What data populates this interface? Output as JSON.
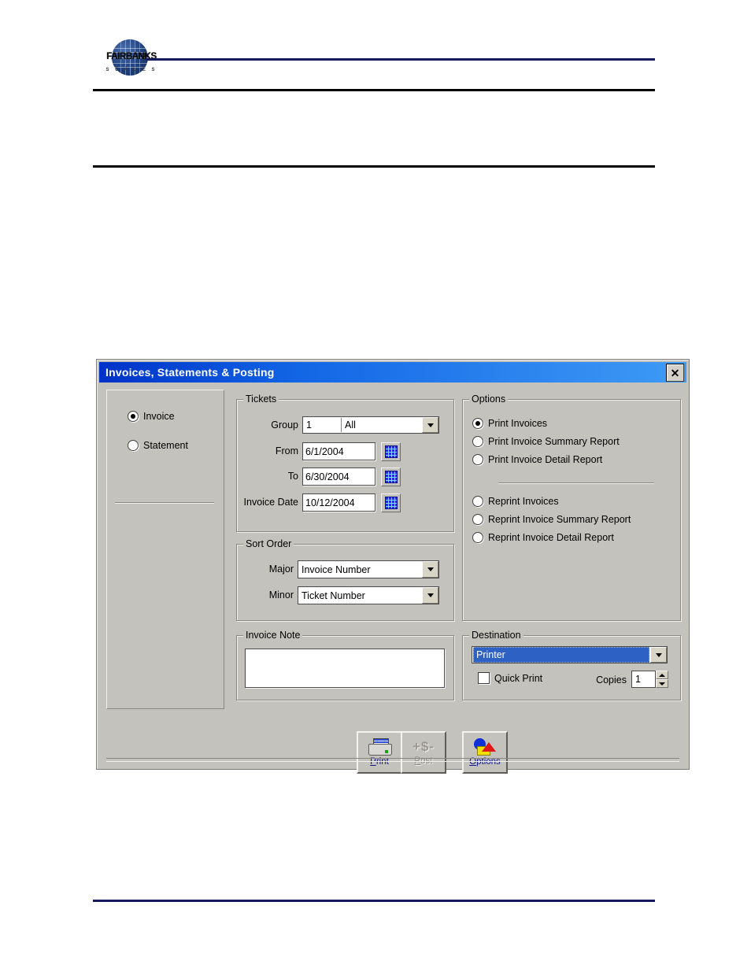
{
  "document": {
    "logo": {
      "word": "FAIRBANKS",
      "sub": "S C A L E S",
      "globe_icon": "globe-icon"
    }
  },
  "dialog": {
    "title": "Invoices, Statements & Posting",
    "close_label": "✕",
    "doc_type": {
      "options": [
        {
          "label": "Invoice",
          "selected": true
        },
        {
          "label": "Statement",
          "selected": false
        }
      ]
    },
    "tickets": {
      "legend": "Tickets",
      "group_label": "Group",
      "group_number": "1",
      "group_name": "All",
      "from_label": "From",
      "from_value": "6/1/2004",
      "to_label": "To",
      "to_value": "6/30/2004",
      "invoice_date_label": "Invoice Date",
      "invoice_date_value": "10/12/2004",
      "calendar_icon": "calendar-icon"
    },
    "sort_order": {
      "legend": "Sort Order",
      "major_label": "Major",
      "major_value": "Invoice Number",
      "minor_label": "Minor",
      "minor_value": "Ticket Number"
    },
    "invoice_note": {
      "legend": "Invoice Note",
      "value": ""
    },
    "options": {
      "legend": "Options",
      "print_group": [
        {
          "label": "Print Invoices",
          "selected": true
        },
        {
          "label": "Print Invoice Summary Report",
          "selected": false
        },
        {
          "label": "Print Invoice Detail Report",
          "selected": false
        }
      ],
      "reprint_group": [
        {
          "label": "Reprint Invoices",
          "selected": false
        },
        {
          "label": "Reprint Invoice Summary Report",
          "selected": false
        },
        {
          "label": "Reprint Invoice Detail Report",
          "selected": false
        }
      ]
    },
    "destination": {
      "legend": "Destination",
      "value": "Printer",
      "quick_print_label": "Quick Print",
      "quick_print_checked": false,
      "copies_label": "Copies",
      "copies_value": "1"
    },
    "toolbar": {
      "print": {
        "label_pre": "P",
        "label_post": "rint",
        "icon": "printer-icon",
        "enabled": true
      },
      "post": {
        "label_pre": "P",
        "label_post": "ost",
        "icon": "dollar-icon",
        "enabled": false
      },
      "options": {
        "label_pre": "O",
        "label_post": "ptions",
        "icon": "shapes-icon",
        "enabled": true
      }
    }
  },
  "colors": {
    "title_start": "#0032c8",
    "title_end": "#3e9bf5",
    "dialog_face": "#c4c2bd",
    "navy_rule": "#15195e",
    "select_blue": "#2d62c4",
    "button_text": "#131a8c"
  }
}
